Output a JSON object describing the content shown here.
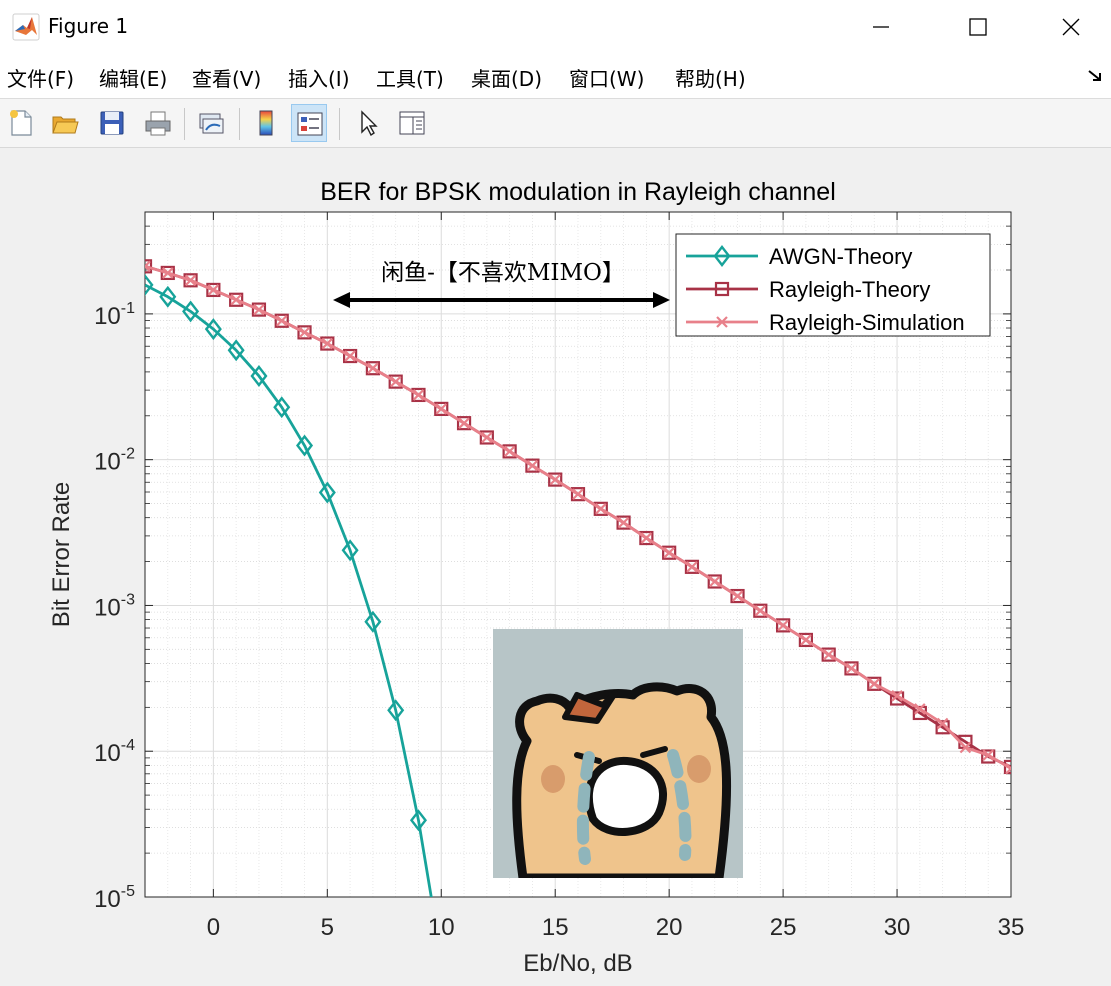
{
  "window": {
    "title": "Figure 1",
    "app_icon": "matlab-icon",
    "controls": [
      "minimize-icon",
      "maximize-icon",
      "close-icon"
    ]
  },
  "menu": {
    "items": [
      "文件(F)",
      "编辑(E)",
      "查看(V)",
      "插入(I)",
      "工具(T)",
      "桌面(D)",
      "窗口(W)",
      "帮助(H)"
    ],
    "overflow_icon": "dock-arrow-icon"
  },
  "toolbar": {
    "icons": [
      "new-figure-icon",
      "open-file-icon",
      "save-icon",
      "print-icon",
      "link-plot-icon",
      "insert-colorbar-icon",
      "insert-legend-icon",
      "edit-plot-arrow-icon",
      "property-inspector-icon"
    ],
    "active": "insert-legend-icon"
  },
  "chart_data": {
    "type": "line",
    "title": "BER for BPSK modulation in Rayleigh channel",
    "xlabel": "Eb/No, dB",
    "ylabel": "Bit Error Rate",
    "xlim": [
      -3,
      35
    ],
    "ylim": [
      1e-05,
      0.5
    ],
    "yscale": "log",
    "grid": true,
    "minor_grid": true,
    "xticks": [
      "0",
      "5",
      "10",
      "15",
      "20",
      "25",
      "30",
      "35"
    ],
    "yticks": [
      {
        "base": "10",
        "exp": "-1"
      },
      {
        "base": "10",
        "exp": "-2"
      },
      {
        "base": "10",
        "exp": "-3"
      },
      {
        "base": "10",
        "exp": "-4"
      },
      {
        "base": "10",
        "exp": "-5"
      }
    ],
    "legend_position": "top-right",
    "annotation": "闲鱼-【不喜欢MIMO】",
    "series": [
      {
        "name": "AWGN-Theory",
        "color": "#17a39a",
        "marker": "diamond",
        "x": [
          -3,
          -2,
          -1,
          0,
          1,
          2,
          3,
          4,
          5,
          6,
          7,
          8,
          9,
          10
        ],
        "y": [
          0.158,
          0.131,
          0.104,
          0.0786,
          0.0563,
          0.0375,
          0.0229,
          0.0125,
          0.00595,
          0.00239,
          0.000773,
          0.000191,
          3.36e-05,
          3.87e-06
        ],
        "marker_max_x": 9
      },
      {
        "name": "Rayleigh-Theory",
        "color": "#a83246",
        "marker": "square",
        "x": [
          -3,
          -2,
          -1,
          0,
          1,
          2,
          3,
          4,
          5,
          6,
          7,
          8,
          9,
          10,
          11,
          12,
          13,
          14,
          15,
          16,
          17,
          18,
          19,
          20,
          21,
          22,
          23,
          24,
          25,
          26,
          27,
          28,
          29,
          30,
          31,
          32,
          33,
          34,
          35
        ],
        "y": [
          0.212,
          0.191,
          0.17,
          0.146,
          0.125,
          0.107,
          0.0897,
          0.0747,
          0.0626,
          0.0514,
          0.0424,
          0.0343,
          0.0278,
          0.0223,
          0.0178,
          0.0142,
          0.0114,
          0.0091,
          0.0073,
          0.0058,
          0.0046,
          0.0037,
          0.0029,
          0.0023,
          0.00184,
          0.00146,
          0.00116,
          0.00092,
          0.00073,
          0.00058,
          0.00046,
          0.00037,
          0.00029,
          0.00023,
          0.000183,
          0.000146,
          0.000116,
          9.2e-05,
          7.8e-05
        ]
      },
      {
        "name": "Rayleigh-Simulation",
        "color": "#e8808a",
        "marker": "x",
        "x": [
          -3,
          -2,
          -1,
          0,
          1,
          2,
          3,
          4,
          5,
          6,
          7,
          8,
          9,
          10,
          11,
          12,
          13,
          14,
          15,
          16,
          17,
          18,
          19,
          20,
          21,
          22,
          23,
          24,
          25,
          26,
          27,
          28,
          29,
          30,
          31,
          32,
          33,
          34,
          35
        ],
        "y": [
          0.212,
          0.191,
          0.17,
          0.146,
          0.125,
          0.107,
          0.0897,
          0.0747,
          0.0626,
          0.0514,
          0.0424,
          0.0343,
          0.0278,
          0.0223,
          0.0178,
          0.0142,
          0.0114,
          0.0091,
          0.0073,
          0.0058,
          0.0046,
          0.0037,
          0.0029,
          0.0023,
          0.00184,
          0.00146,
          0.00116,
          0.00092,
          0.00073,
          0.00058,
          0.00046,
          0.00037,
          0.00029,
          0.00024,
          0.000195,
          0.000155,
          0.000106,
          9.4e-05,
          7.6e-05
        ]
      }
    ]
  }
}
